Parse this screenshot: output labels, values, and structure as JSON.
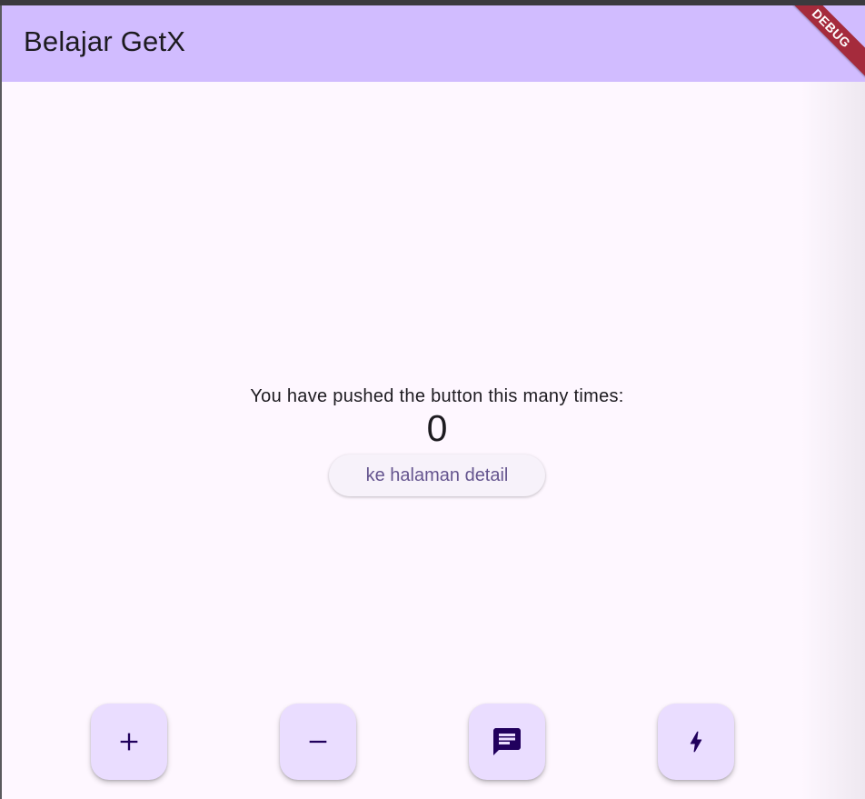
{
  "app_bar": {
    "title": "Belajar GetX",
    "background_color": "#d1bcff"
  },
  "debug_banner": {
    "label": "DEBUG",
    "color": "#a52b3c"
  },
  "main": {
    "message": "You have pushed the button this many times:",
    "counter": "0",
    "detail_button_label": "ke halaman detail"
  },
  "fabs": [
    {
      "icon": "add-icon",
      "symbol": "+"
    },
    {
      "icon": "remove-icon",
      "symbol": "−"
    },
    {
      "icon": "message-icon"
    },
    {
      "icon": "flash-icon"
    }
  ],
  "colors": {
    "background": "#fef7ff",
    "fab_background": "#eaddff",
    "fab_icon": "#21005d",
    "button_text": "#65558f"
  }
}
